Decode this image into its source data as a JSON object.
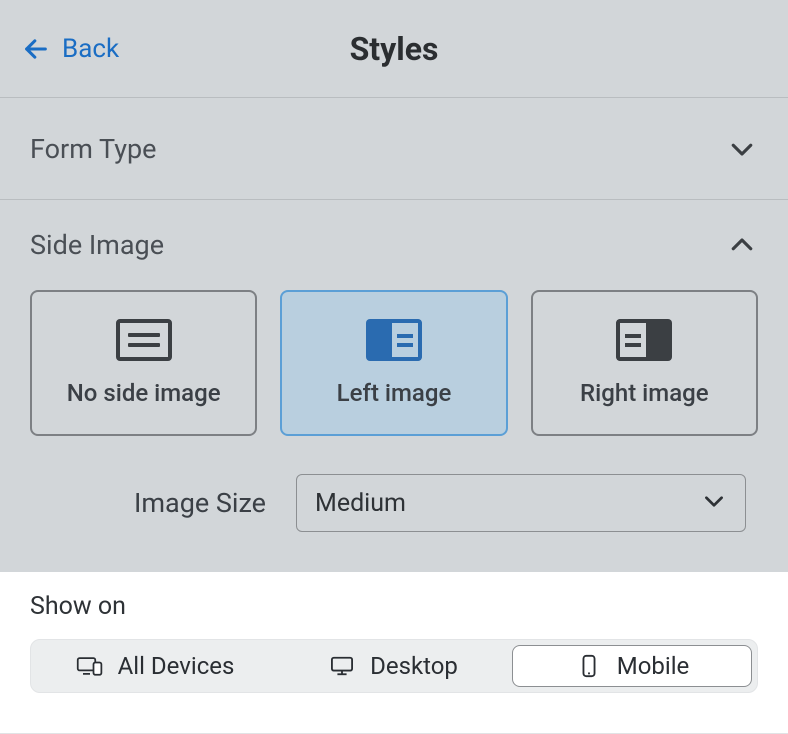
{
  "header": {
    "back_label": "Back",
    "title": "Styles"
  },
  "sections": {
    "form_type": {
      "label": "Form Type",
      "expanded": false
    },
    "side_image": {
      "label": "Side Image",
      "expanded": true
    }
  },
  "side_image_options": [
    {
      "id": "none",
      "label": "No side image",
      "selected": false
    },
    {
      "id": "left",
      "label": "Left image",
      "selected": true
    },
    {
      "id": "right",
      "label": "Right image",
      "selected": false
    }
  ],
  "image_size": {
    "label": "Image Size",
    "value": "Medium"
  },
  "show_on": {
    "label": "Show on",
    "options": [
      {
        "id": "all",
        "label": "All Devices",
        "selected": false
      },
      {
        "id": "desktop",
        "label": "Desktop",
        "selected": false
      },
      {
        "id": "mobile",
        "label": "Mobile",
        "selected": true
      }
    ]
  }
}
